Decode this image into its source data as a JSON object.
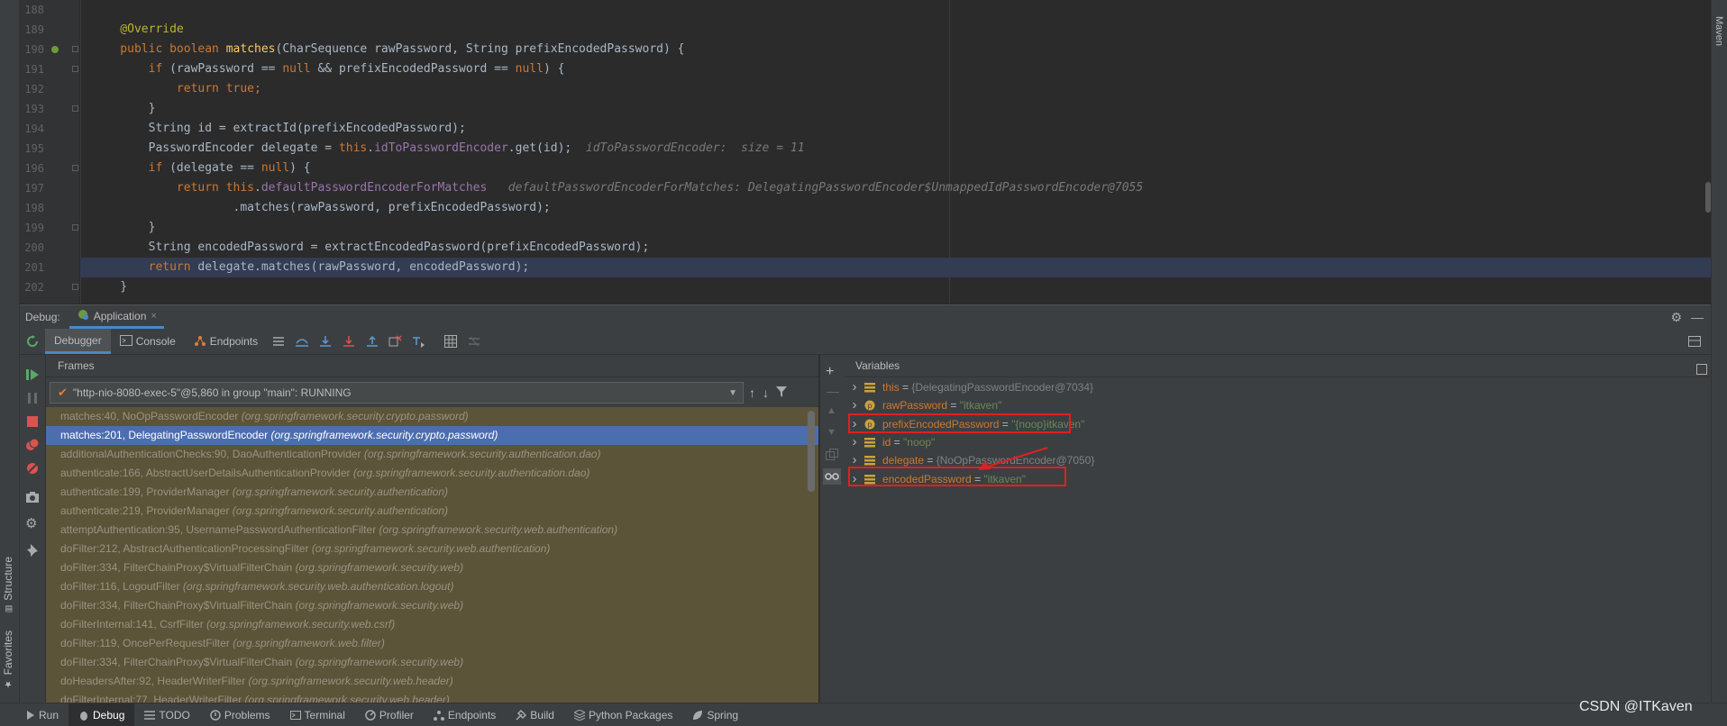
{
  "editor": {
    "lines": [
      {
        "num": "188",
        "segs": []
      },
      {
        "num": "189",
        "segs": [
          {
            "c": "an",
            "t": "    @Override"
          }
        ]
      },
      {
        "num": "190",
        "segs": [
          {
            "c": "kw",
            "t": "    public boolean "
          },
          {
            "c": "fn",
            "t": "matches"
          },
          {
            "c": "tx",
            "t": "(CharSequence rawPassword, String prefixEncodedPassword) {"
          }
        ]
      },
      {
        "num": "191",
        "segs": [
          {
            "c": "kw",
            "t": "        if "
          },
          {
            "c": "tx",
            "t": "(rawPassword == "
          },
          {
            "c": "kw",
            "t": "null "
          },
          {
            "c": "tx",
            "t": "&& prefixEncodedPassword == "
          },
          {
            "c": "kw",
            "t": "null"
          },
          {
            "c": "tx",
            "t": ") {"
          }
        ]
      },
      {
        "num": "192",
        "segs": [
          {
            "c": "kw",
            "t": "            return true;"
          }
        ]
      },
      {
        "num": "193",
        "segs": [
          {
            "c": "tx",
            "t": "        }"
          }
        ]
      },
      {
        "num": "194",
        "segs": [
          {
            "c": "tx",
            "t": "        String id = extractId(prefixEncodedPassword);"
          }
        ]
      },
      {
        "num": "195",
        "segs": [
          {
            "c": "tx",
            "t": "        PasswordEncoder delegate = "
          },
          {
            "c": "kw",
            "t": "this"
          },
          {
            "c": "tx",
            "t": "."
          },
          {
            "c": "fld",
            "t": "idToPasswordEncoder"
          },
          {
            "c": "tx",
            "t": ".get(id);  "
          },
          {
            "c": "cm",
            "t": "idToPasswordEncoder:  size = 11"
          }
        ]
      },
      {
        "num": "196",
        "segs": [
          {
            "c": "kw",
            "t": "        if "
          },
          {
            "c": "tx",
            "t": "(delegate == "
          },
          {
            "c": "kw",
            "t": "null"
          },
          {
            "c": "tx",
            "t": ") {"
          }
        ]
      },
      {
        "num": "197",
        "segs": [
          {
            "c": "kw",
            "t": "            return this"
          },
          {
            "c": "tx",
            "t": "."
          },
          {
            "c": "fld",
            "t": "defaultPasswordEncoderForMatches"
          },
          {
            "c": "tx",
            "t": "   "
          },
          {
            "c": "cm",
            "t": "defaultPasswordEncoderForMatches: DelegatingPasswordEncoder$UnmappedIdPasswordEncoder@7055"
          }
        ]
      },
      {
        "num": "198",
        "segs": [
          {
            "c": "tx",
            "t": "                    .matches(rawPassword, prefixEncodedPassword);"
          }
        ]
      },
      {
        "num": "199",
        "segs": [
          {
            "c": "tx",
            "t": "        }"
          }
        ]
      },
      {
        "num": "200",
        "segs": [
          {
            "c": "tx",
            "t": "        String encodedPassword = extractEncodedPassword(prefixEncodedPassword);"
          }
        ]
      },
      {
        "num": "201",
        "segs": [
          {
            "c": "kw",
            "t": "        return "
          },
          {
            "c": "tx",
            "t": "delegate.matches(rawPassword, encodedPassword);"
          }
        ]
      },
      {
        "num": "202",
        "segs": [
          {
            "c": "tx",
            "t": "    }"
          }
        ]
      }
    ],
    "current_line": "201"
  },
  "debug": {
    "label": "Debug:",
    "session_tab": "Application",
    "tabs": [
      "Debugger",
      "Console",
      "Endpoints"
    ]
  },
  "frames": {
    "title": "Frames",
    "thread": "\"http-nio-8080-exec-5\"@5,860 in group \"main\": RUNNING",
    "items": [
      {
        "m": "matches:40, NoOpPasswordEncoder ",
        "p": "(org.springframework.security.crypto.password)"
      },
      {
        "m": "matches:201, DelegatingPasswordEncoder ",
        "p": "(org.springframework.security.crypto.password)",
        "selected": true
      },
      {
        "m": "additionalAuthenticationChecks:90, DaoAuthenticationProvider ",
        "p": "(org.springframework.security.authentication.dao)"
      },
      {
        "m": "authenticate:166, AbstractUserDetailsAuthenticationProvider ",
        "p": "(org.springframework.security.authentication.dao)"
      },
      {
        "m": "authenticate:199, ProviderManager ",
        "p": "(org.springframework.security.authentication)"
      },
      {
        "m": "authenticate:219, ProviderManager ",
        "p": "(org.springframework.security.authentication)"
      },
      {
        "m": "attemptAuthentication:95, UsernamePasswordAuthenticationFilter ",
        "p": "(org.springframework.security.web.authentication)"
      },
      {
        "m": "doFilter:212, AbstractAuthenticationProcessingFilter ",
        "p": "(org.springframework.security.web.authentication)"
      },
      {
        "m": "doFilter:334, FilterChainProxy$VirtualFilterChain ",
        "p": "(org.springframework.security.web)"
      },
      {
        "m": "doFilter:116, LogoutFilter ",
        "p": "(org.springframework.security.web.authentication.logout)"
      },
      {
        "m": "doFilter:334, FilterChainProxy$VirtualFilterChain ",
        "p": "(org.springframework.security.web)"
      },
      {
        "m": "doFilterInternal:141, CsrfFilter ",
        "p": "(org.springframework.security.web.csrf)"
      },
      {
        "m": "doFilter:119, OncePerRequestFilter ",
        "p": "(org.springframework.web.filter)"
      },
      {
        "m": "doFilter:334, FilterChainProxy$VirtualFilterChain ",
        "p": "(org.springframework.security.web)"
      },
      {
        "m": "doHeadersAfter:92, HeaderWriterFilter ",
        "p": "(org.springframework.security.web.header)"
      },
      {
        "m": "doFilterInternal:77, HeaderWriterFilter ",
        "p": "(org.springframework.security.web.header)"
      }
    ]
  },
  "variables": {
    "title": "Variables",
    "items": [
      {
        "icon": "field",
        "name": "this",
        "value": "{DelegatingPasswordEncoder@7034}",
        "vtype": "obj"
      },
      {
        "icon": "param",
        "name": "rawPassword",
        "value": "\"itkaven\"",
        "vtype": "str"
      },
      {
        "icon": "param",
        "name": "prefixEncodedPassword",
        "value": "\"{noop}itkaven\"",
        "vtype": "str"
      },
      {
        "icon": "field",
        "name": "id",
        "value": "\"noop\"",
        "vtype": "str"
      },
      {
        "icon": "field",
        "name": "delegate",
        "value": "{NoOpPasswordEncoder@7050}",
        "vtype": "obj"
      },
      {
        "icon": "field",
        "name": "encodedPassword",
        "value": "\"itkaven\"",
        "vtype": "str"
      }
    ]
  },
  "sidebar": {
    "left_tabs": [
      "Structure",
      "Favorites"
    ],
    "right_tabs": [
      "Maven"
    ]
  },
  "bottom_tabs": [
    "Run",
    "Debug",
    "TODO",
    "Problems",
    "Terminal",
    "Profiler",
    "Endpoints",
    "Build",
    "Python Packages",
    "Spring"
  ],
  "watermark": "CSDN @ITKaven",
  "colors": {
    "highlight_box": "#e02020",
    "selected_frame": "#4b6eaf",
    "frames_bg": "#5c5439"
  }
}
